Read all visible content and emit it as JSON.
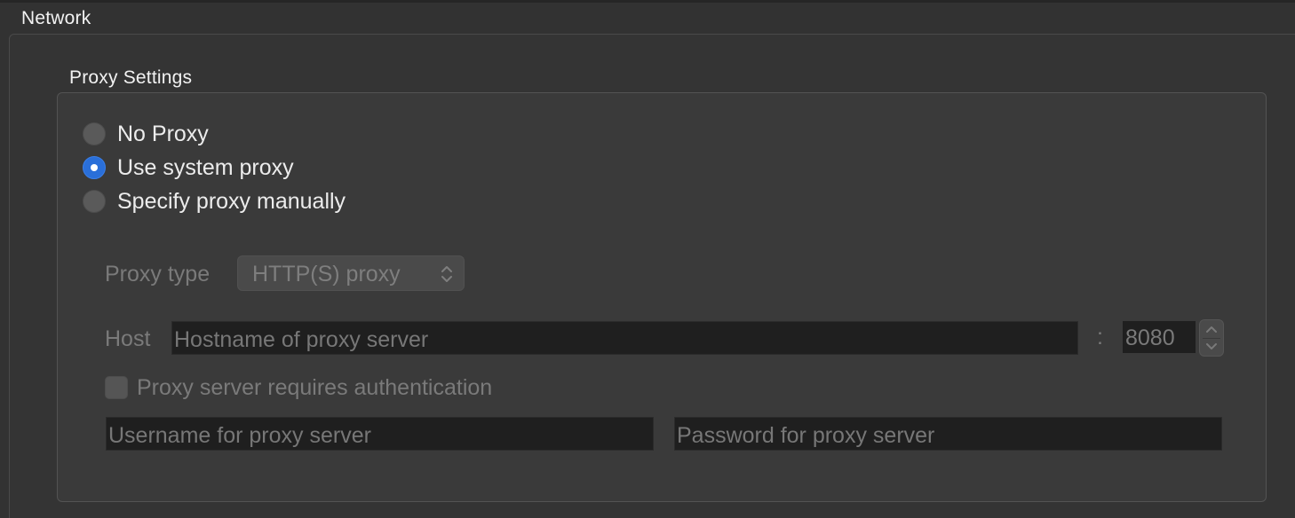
{
  "section": {
    "title": "Network"
  },
  "proxy_settings": {
    "title": "Proxy Settings",
    "options": [
      {
        "label": "No Proxy",
        "selected": false
      },
      {
        "label": "Use system proxy",
        "selected": true
      },
      {
        "label": "Specify proxy manually",
        "selected": false
      }
    ],
    "proxy_type": {
      "label": "Proxy type",
      "value": "HTTP(S) proxy",
      "enabled": false
    },
    "host": {
      "label": "Host",
      "placeholder": "Hostname of proxy server",
      "value": "",
      "separator": ":",
      "port": "8080",
      "enabled": false
    },
    "auth": {
      "label": "Proxy server requires authentication",
      "checked": false,
      "enabled": false,
      "username_placeholder": "Username for proxy server",
      "password_placeholder": "Password for proxy server"
    }
  },
  "colors": {
    "background": "#323232",
    "accent": "#2a6fd9",
    "text": "#ececec",
    "disabled_text": "#7a7a7a",
    "field_background": "#1f1f1f"
  }
}
